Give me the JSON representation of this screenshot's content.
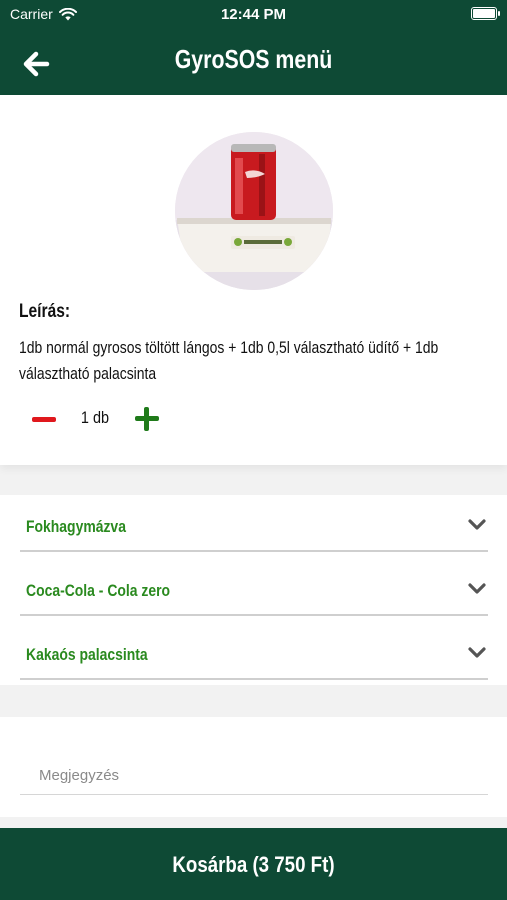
{
  "status_bar": {
    "carrier": "Carrier",
    "time": "12:44 PM"
  },
  "header": {
    "title": "GyroSOS menü",
    "back_icon": "arrow-left-icon"
  },
  "product": {
    "image_icon": "product-photo",
    "description_label": "Leírás:",
    "description": "1db normál gyrosos töltött lángos + 1db 0,5l választható üdítő + 1db választható palacsinta"
  },
  "quantity": {
    "value": "1 db",
    "minus_color": "#e0181d",
    "plus_color": "#1f7a1a"
  },
  "options": [
    {
      "label": "Fokhagymázva"
    },
    {
      "label": "Coca-Cola - Cola zero"
    },
    {
      "label": "Kakaós palacsinta"
    }
  ],
  "note": {
    "placeholder": "Megjegyzés",
    "value": ""
  },
  "cart": {
    "label": "Kosárba (3 750 Ft)"
  },
  "colors": {
    "brand": "#0e4a35",
    "option_text": "#2a8a1f"
  }
}
